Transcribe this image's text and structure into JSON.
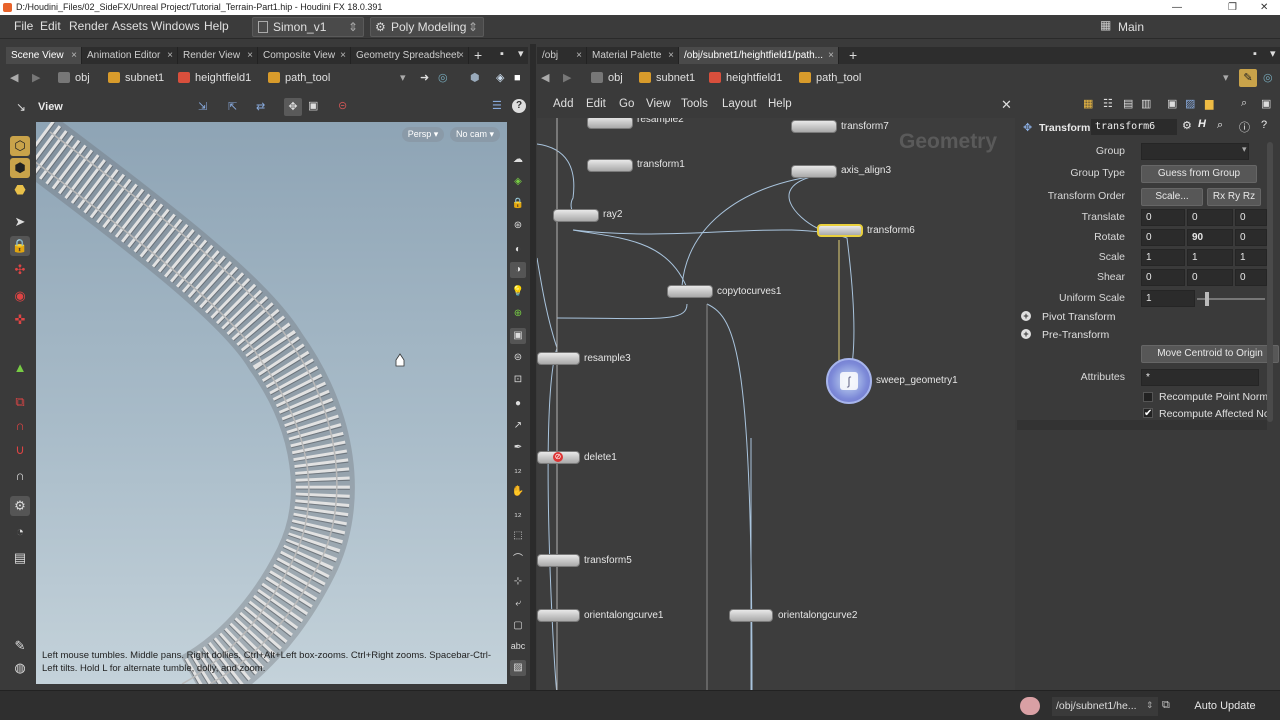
{
  "window": {
    "title": "D:/Houdini_Files/02_SideFX/Unreal Project/Tutorial_Terrain-Part1.hip - Houdini FX 18.0.391",
    "min": "—",
    "max": "❐",
    "close": "✕"
  },
  "menubar": {
    "items": [
      "File",
      "Edit",
      "Render",
      "Assets",
      "Windows",
      "Help"
    ],
    "desktop": "Simon_v1",
    "shelf": "Poly Modeling",
    "main_desktop": "Main"
  },
  "left_pane": {
    "tabs": [
      "Scene View",
      "Animation Editor",
      "Render View",
      "Composite View",
      "Geometry Spreadsheet"
    ],
    "path": [
      "obj",
      "subnet1",
      "heightfield1",
      "path_tool"
    ],
    "view_label": "View",
    "persp": "Persp ▾",
    "cam": "No cam ▾",
    "help_text": "Left mouse tumbles. Middle pans. Right dollies. Ctrl+Alt+Left box-zooms. Ctrl+Right zooms. Spacebar-Ctrl-Left tilts. Hold L for alternate tumble, dolly, and zoom."
  },
  "right_pane": {
    "tabs": [
      "/obj",
      "Material Palette",
      "/obj/subnet1/heightfield1/path..."
    ],
    "path": [
      "obj",
      "subnet1",
      "heightfield1",
      "path_tool"
    ],
    "menu": [
      "Add",
      "Edit",
      "Go",
      "View",
      "Tools",
      "Layout",
      "Help"
    ],
    "network_type": "Geometry"
  },
  "nodes": {
    "resample2": "resample2",
    "transform1": "transform1",
    "ray2": "ray2",
    "transform7": "transform7",
    "axis_align3": "axis_align3",
    "transform6": "transform6",
    "copytocurves1": "copytocurves1",
    "resample3": "resample3",
    "sweep_geometry1": "sweep_geometry1",
    "delete1": "delete1",
    "transform5": "transform5",
    "orientalongcurve1": "orientalongcurve1",
    "orientalongcurve2": "orientalongcurve2"
  },
  "params": {
    "node_type": "Transform",
    "node_name": "transform6",
    "group_label": "Group",
    "group_value": "",
    "group_type_label": "Group Type",
    "group_type_value": "Guess from Group",
    "transform_order_label": "Transform Order",
    "transform_order_value": "Scale...",
    "rot_order_value": "Rx Ry Rz",
    "translate_label": "Translate",
    "translate": [
      "0",
      "0",
      "0"
    ],
    "rotate_label": "Rotate",
    "rotate": [
      "0",
      "90",
      "0"
    ],
    "scale_label": "Scale",
    "scale": [
      "1",
      "1",
      "1"
    ],
    "shear_label": "Shear",
    "shear": [
      "0",
      "0",
      "0"
    ],
    "uniform_scale_label": "Uniform Scale",
    "uniform_scale": "1",
    "pivot_transform": "Pivot Transform",
    "pre_transform": "Pre-Transform",
    "move_centroid": "Move Centroid to Origin",
    "attributes_label": "Attributes",
    "attributes_value": "*",
    "recompute_normals": "Recompute Point Norma",
    "recompute_affected": "Recompute Affected No"
  },
  "status": {
    "path": "/obj/subnet1/he...",
    "update_mode": "Auto Update"
  }
}
